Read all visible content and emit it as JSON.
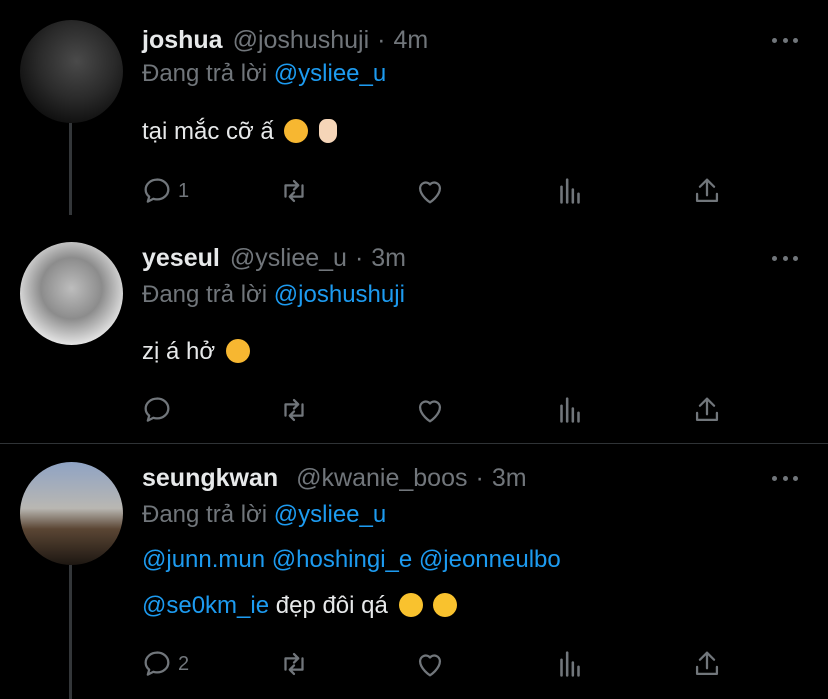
{
  "tweets": [
    {
      "name": "joshua",
      "handle": "@joshushuji",
      "time": "4m",
      "replying_label": "Đang trả lời",
      "replying_to": "@ysliee_u",
      "lines": [
        "tại mắc cỡ ấ"
      ],
      "emojis": [
        "kissing-cat-emoji",
        "pinching-hand-emoji"
      ],
      "reply_count": "1",
      "avatar_colors": [
        "#3a3a3a",
        "#141414"
      ]
    },
    {
      "name": "yeseul",
      "handle": "@ysliee_u",
      "time": "3m",
      "replying_label": "Đang trả lời",
      "replying_to": "@joshushuji",
      "lines": [
        "zị á hở"
      ],
      "emojis": [
        "smirking-cat-emoji"
      ],
      "reply_count": "",
      "avatar_colors": [
        "#d8d8d8",
        "#6b6b6b"
      ]
    },
    {
      "name": "seungkwan",
      "handle": "@kwanie_boos",
      "time": "3m",
      "replying_label": "Đang trả lời",
      "replying_to": "@ysliee_u",
      "mentions_line1": [
        "@junn.mun",
        "@hoshingi_e",
        "@jeonneulbo"
      ],
      "mention_line2": "@se0km_ie",
      "text_line2": "đẹp đôi qá",
      "emojis": [
        "heart-eyes-emoji",
        "heart-eyes-emoji"
      ],
      "reply_count": "2",
      "avatar_colors": [
        "#7a8aa6",
        "#3b2d22"
      ]
    }
  ],
  "colors": {
    "background": "#000000",
    "link": "#1d9bf0",
    "muted": "#71767b",
    "text": "#e7e9ea"
  },
  "icons": [
    "reply-icon",
    "retweet-icon",
    "like-icon",
    "views-icon",
    "share-icon",
    "more-icon"
  ]
}
